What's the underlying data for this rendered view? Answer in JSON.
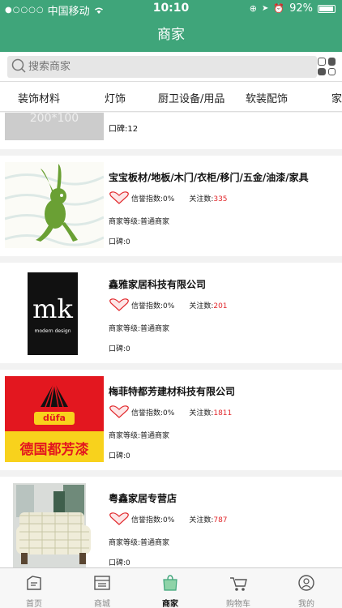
{
  "status_bar": {
    "carrier": "中国移动",
    "time": "10:10",
    "battery": "92%"
  },
  "nav": {
    "title": "商家"
  },
  "search": {
    "placeholder": "搜索商家"
  },
  "categories": [
    "装饰材料",
    "灯饰",
    "厨卫设备/用品",
    "软装配饰",
    "家"
  ],
  "partial_item": {
    "thumb_text": "200*100",
    "reputation": "口碑:12"
  },
  "merchants": [
    {
      "title": "宝宝板材/地板/木门/衣柜/移门/五金/油漆/家具",
      "credit": "信誉指数:0%",
      "follow_label": "关注数:",
      "follow_count": "335",
      "level": "商家等级:普通商家",
      "reputation": "口碑:0"
    },
    {
      "title": "鑫雅家居科技有限公司",
      "credit": "信誉指数:0%",
      "follow_label": "关注数:",
      "follow_count": "201",
      "level": "商家等级:普通商家",
      "reputation": "口碑:0",
      "logo_text_main": "mk",
      "logo_text_sub": "modern design"
    },
    {
      "title": "梅菲特都芳建材科技有限公司",
      "credit": "信誉指数:0%",
      "follow_label": "关注数:",
      "follow_count": "1811",
      "level": "商家等级:普通商家",
      "reputation": "口碑:0",
      "logo_text_main": "düfa",
      "logo_text_sub": "德国都芳漆"
    },
    {
      "title": "粤鑫家居专营店",
      "credit": "信誉指数:0%",
      "follow_label": "关注数:",
      "follow_count": "787",
      "level": "商家等级:普通商家",
      "reputation": "口碑:0"
    }
  ],
  "tabs": [
    {
      "label": "首页",
      "icon": "home-icon"
    },
    {
      "label": "商城",
      "icon": "mall-icon"
    },
    {
      "label": "商家",
      "icon": "bag-icon"
    },
    {
      "label": "购物车",
      "icon": "cart-icon"
    },
    {
      "label": "我的",
      "icon": "profile-icon"
    }
  ],
  "colors": {
    "brand_green": "#3fa57a",
    "follow_red": "#e1272b",
    "dufa_red": "#e3171f",
    "dufa_yellow": "#f8d21c"
  }
}
